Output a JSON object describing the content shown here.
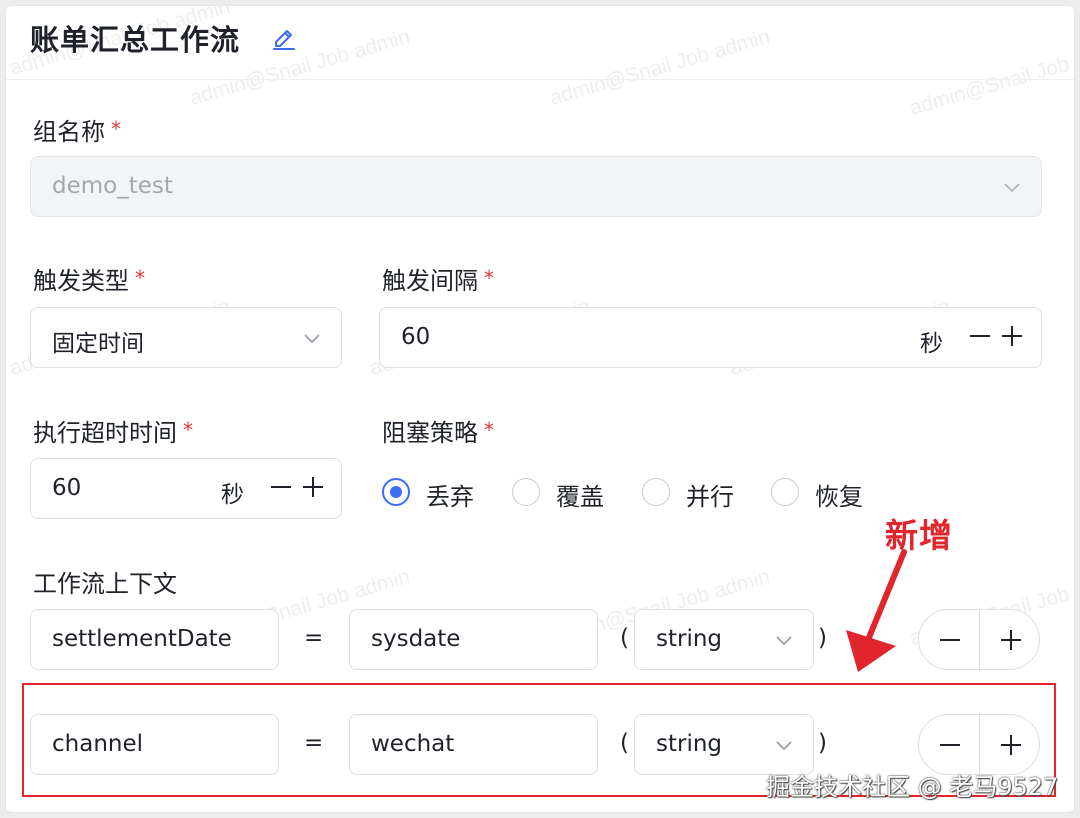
{
  "header": {
    "title": "账单汇总工作流"
  },
  "form": {
    "group_name": {
      "label": "组名称",
      "required_mark": "*",
      "value": "demo_test"
    },
    "trigger_type": {
      "label": "触发类型",
      "required_mark": "*",
      "value": "固定时间"
    },
    "trigger_interval": {
      "label": "触发间隔",
      "required_mark": "*",
      "value": "60",
      "unit": "秒"
    },
    "exec_timeout": {
      "label": "执行超时时间",
      "required_mark": "*",
      "value": "60",
      "unit": "秒"
    },
    "block_strategy": {
      "label": "阻塞策略",
      "required_mark": "*",
      "options": [
        "丢弃",
        "覆盖",
        "并行",
        "恢复"
      ],
      "selected": "丢弃"
    },
    "context": {
      "label": "工作流上下文",
      "rows": [
        {
          "key": "settlementDate",
          "eq": "=",
          "value": "sysdate",
          "open_paren": "(",
          "type": "string",
          "close_paren": ")"
        },
        {
          "key": "channel",
          "eq": "=",
          "value": "wechat",
          "open_paren": "(",
          "type": "string",
          "close_paren": ")"
        }
      ]
    }
  },
  "annotation": {
    "text": "新增"
  },
  "watermark": {
    "text": "admin@Snail Job admin",
    "footer": "掘金技术社区 @ 老马9527"
  },
  "colors": {
    "accent": "#3b6ef5",
    "required": "#e5383b",
    "annotation": "#e0262c",
    "border": "#dcdfe6"
  },
  "icons": {
    "edit": "edit-icon",
    "chevron": "chevron-down-icon",
    "minus": "minus-icon",
    "plus": "plus-icon"
  }
}
